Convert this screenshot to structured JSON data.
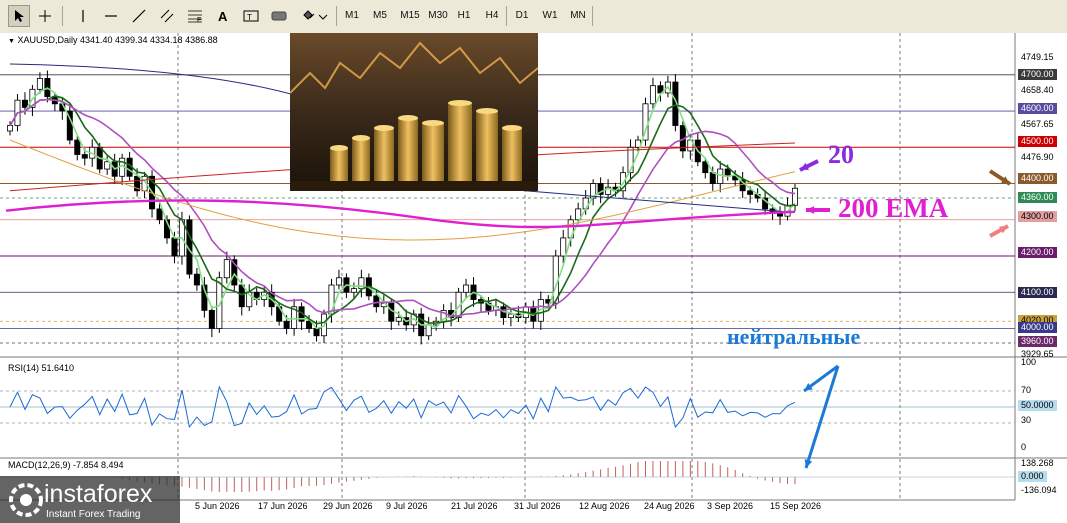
{
  "toolbar": {
    "timeframes": [
      "M1",
      "M5",
      "M15",
      "M30",
      "H1",
      "H4",
      "D1",
      "W1",
      "MN"
    ],
    "tools": [
      "cursor-icon",
      "crosshair-icon",
      "vertical-line-icon",
      "horizontal-line-icon",
      "trendline-icon",
      "equidistant-channel-icon",
      "fibonacci-icon",
      "text-icon",
      "text-label-icon",
      "rectangle-label-icon",
      "shapes-icon"
    ]
  },
  "chart": {
    "header": "XAUUSD,Daily  4341.40 4399.34 4334.18 4386.88",
    "price_ticks": [
      "4749.15",
      "4658.40",
      "4567.65",
      "4476.90",
      "3929.65"
    ],
    "price_tags": [
      {
        "text": "4700.00",
        "bg": "#3a3a3a",
        "fg": "#ffffff"
      },
      {
        "text": "4600.00",
        "bg": "#5a4aa0",
        "fg": "#ffffff"
      },
      {
        "text": "4500.00",
        "bg": "#cc0000",
        "fg": "#ffffff"
      },
      {
        "text": "4400.00",
        "bg": "#8b5a2b",
        "fg": "#ffffff"
      },
      {
        "text": "4360.00",
        "bg": "#2e8b57",
        "fg": "#ffffff"
      },
      {
        "text": "4300.00",
        "bg": "#e0a0a0",
        "fg": "#000000"
      },
      {
        "text": "4200.00",
        "bg": "#6a1b6a",
        "fg": "#ffffff"
      },
      {
        "text": "4100.00",
        "bg": "#2a2a50",
        "fg": "#ffffff"
      },
      {
        "text": "4020.00",
        "bg": "#c8a040",
        "fg": "#000000"
      },
      {
        "text": "4000.00",
        "bg": "#3a3a8a",
        "fg": "#ffffff"
      },
      {
        "text": "3960.00",
        "bg": "#6a2a6a",
        "fg": "#ffffff"
      }
    ],
    "dates": [
      "5 Jun 2026",
      "17 Jun 2026",
      "29 Jun 2026",
      "9 Jul 2026",
      "21 Jul 2026",
      "31 Jul 2026",
      "12 Aug 2026",
      "24 Aug 2026",
      "3 Sep 2026",
      "15 Sep 2026"
    ],
    "rsi": {
      "header": "RSI(14) 51.6410",
      "ticks": [
        "70",
        "30",
        "0"
      ],
      "top": "100",
      "tag": "50.0000"
    },
    "macd": {
      "header": "MACD(12,26,9) -7.854 8.494",
      "top": "138.268",
      "zero": "0.000",
      "bottom": "-136.094"
    }
  },
  "annotations": {
    "label_20": "20",
    "label_ema": "200 EMA",
    "label_neutral": "нейтральные"
  },
  "logo": {
    "brand": "instaforex",
    "tagline": "Instant Forex Trading"
  },
  "colors": {
    "bull": "#ffffff",
    "bear": "#000000",
    "ema200": "#e020d0",
    "ma20": "#b050c0",
    "ma_green": "#1a6a1a",
    "ma_lightgreen": "#80e080",
    "ma_orange": "#e0a040",
    "ma_red": "#cc2020",
    "ma_navy": "#2a2a80",
    "annotation_purple": "#8a2be2",
    "annotation_magenta": "#e020d0",
    "annotation_blue": "#1a7ad6"
  },
  "chart_data": {
    "type": "candlestick",
    "symbol": "XAUUSD",
    "timeframe": "Daily",
    "ohlc_last": {
      "open": 4341.4,
      "high": 4399.34,
      "low": 4334.18,
      "close": 4386.88
    },
    "ylim": [
      3929.65,
      4749.15
    ],
    "x_dates": [
      "5 Jun 2026",
      "17 Jun 2026",
      "29 Jun 2026",
      "9 Jul 2026",
      "21 Jul 2026",
      "31 Jul 2026",
      "12 Aug 2026",
      "24 Aug 2026",
      "3 Sep 2026",
      "15 Sep 2026"
    ],
    "closes": [
      4560,
      4630,
      4610,
      4660,
      4690,
      4640,
      4620,
      4600,
      4520,
      4480,
      4470,
      4500,
      4440,
      4460,
      4420,
      4470,
      4420,
      4380,
      4420,
      4330,
      4300,
      4250,
      4200,
      4300,
      4150,
      4120,
      4050,
      4000,
      4140,
      4190,
      4120,
      4060,
      4100,
      4080,
      4100,
      4060,
      4020,
      4000,
      4060,
      4020,
      4000,
      3980,
      4040,
      4120,
      4140,
      4100,
      4110,
      4140,
      4090,
      4060,
      4070,
      4020,
      4030,
      4010,
      4040,
      3980,
      4010,
      4020,
      4050,
      4030,
      4100,
      4120,
      4080,
      4070,
      4050,
      4060,
      4030,
      4040,
      4030,
      4060,
      4020,
      4080,
      4070,
      4200,
      4250,
      4300,
      4330,
      4360,
      4400,
      4370,
      4390,
      4380,
      4430,
      4500,
      4520,
      4620,
      4670,
      4650,
      4680,
      4560,
      4490,
      4520,
      4460,
      4430,
      4400,
      4440,
      4420,
      4410,
      4380,
      4370,
      4360,
      4330,
      4320,
      4310,
      4340,
      4387
    ],
    "rsi": {
      "value": 51.641,
      "levels": [
        70,
        50,
        30
      ],
      "range": [
        0,
        100
      ]
    },
    "macd": {
      "main": -7.854,
      "signal": 8.494,
      "range": [
        -136.094,
        138.268
      ]
    }
  }
}
